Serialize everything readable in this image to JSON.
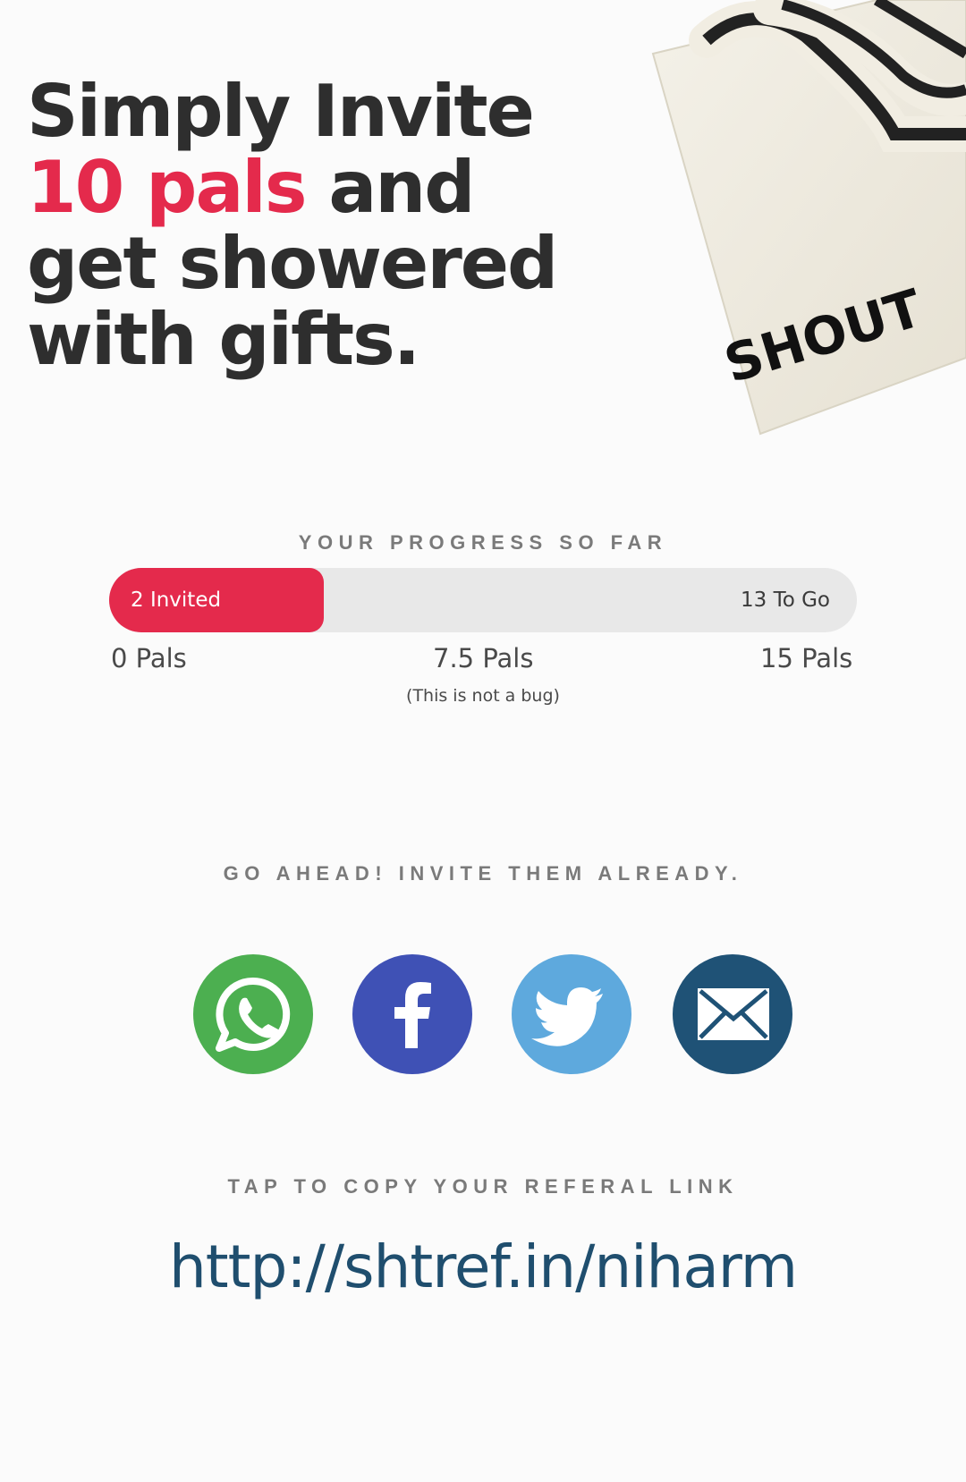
{
  "headline": {
    "line1": "Simply Invite",
    "accent": "10 pals",
    "line2_rest": " and",
    "line3": "get showered",
    "line4": "with gifts."
  },
  "tote": {
    "brand_text": "SHOUT"
  },
  "progress": {
    "label": "YOUR PROGRESS SO FAR",
    "invited_label": "2 Invited",
    "togo_label": "13 To Go",
    "fill_fraction": 0.287,
    "scale": {
      "min": "0 Pals",
      "mid": "7.5 Pals",
      "max": "15 Pals",
      "note": "(This is not a bug)"
    },
    "colors": {
      "fill": "#e42a4c",
      "track": "#e8e8e8"
    }
  },
  "share": {
    "label": "GO AHEAD! INVITE THEM ALREADY.",
    "buttons": [
      {
        "icon": "whatsapp-icon",
        "color": "#4caf50"
      },
      {
        "icon": "facebook-icon",
        "color": "#3f51b5"
      },
      {
        "icon": "twitter-icon",
        "color": "#5ea9dd"
      },
      {
        "icon": "email-icon",
        "color": "#1f5276"
      }
    ]
  },
  "referral": {
    "label": "TAP TO COPY YOUR REFERAL LINK",
    "link": "http://shtref.in/niharm"
  }
}
